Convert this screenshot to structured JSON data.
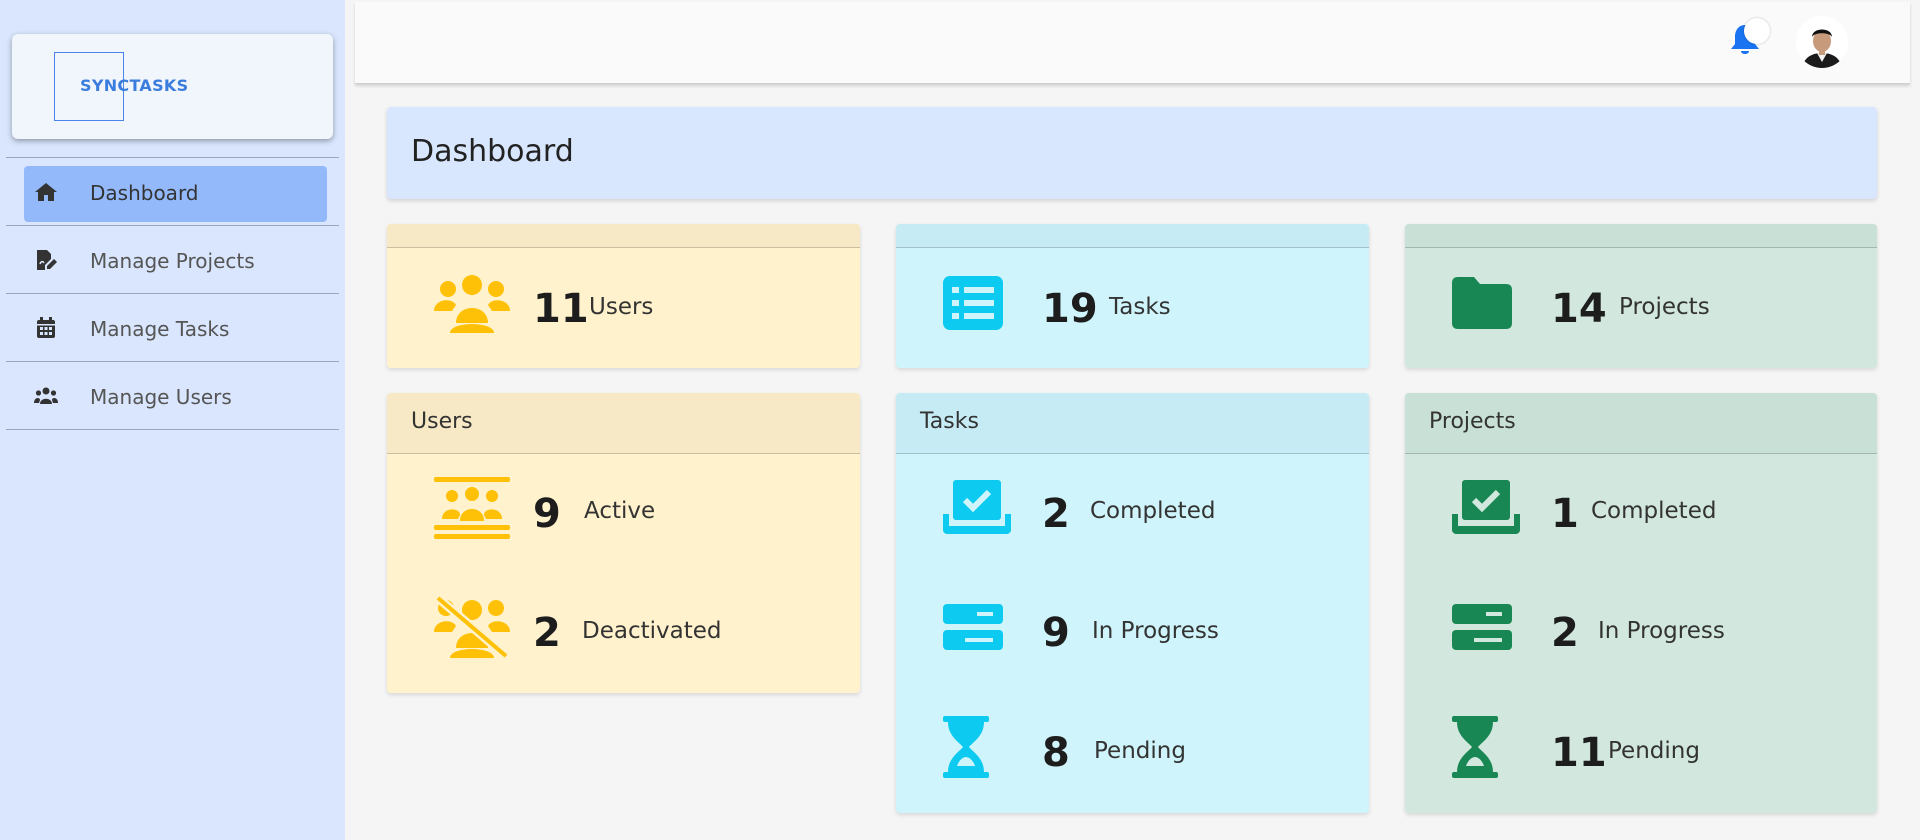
{
  "logo": {
    "text": "SYNCTASKS"
  },
  "sidebar": {
    "items": [
      {
        "label": "Dashboard",
        "icon": "home-icon",
        "active": true
      },
      {
        "label": "Manage Projects",
        "icon": "edit-document-icon"
      },
      {
        "label": "Manage Tasks",
        "icon": "calendar-icon"
      },
      {
        "label": "Manage Users",
        "icon": "users-icon"
      }
    ]
  },
  "topbar": {
    "bell_icon": "bell-icon",
    "avatar": "user-avatar"
  },
  "page": {
    "title": "Dashboard"
  },
  "colors": {
    "yellow": "#ffc107",
    "cyan": "#0dcaf0",
    "green": "#198754",
    "nav_active": "#93b9fb"
  },
  "summary": {
    "users": {
      "value": "11",
      "label": "Users"
    },
    "tasks": {
      "value": "19",
      "label": "Tasks"
    },
    "projects": {
      "value": "14",
      "label": "Projects"
    }
  },
  "users_card": {
    "title": "Users",
    "active": {
      "value": "9",
      "label": "Active"
    },
    "deactivated": {
      "value": "2",
      "label": "Deactivated"
    }
  },
  "tasks_card": {
    "title": "Tasks",
    "completed": {
      "value": "2",
      "label": "Completed"
    },
    "in_progress": {
      "value": "9",
      "label": "In Progress"
    },
    "pending": {
      "value": "8",
      "label": "Pending"
    }
  },
  "projects_card": {
    "title": "Projects",
    "completed": {
      "value": "1",
      "label": "Completed"
    },
    "in_progress": {
      "value": "2",
      "label": "In Progress"
    },
    "pending": {
      "value": "11",
      "label": "Pending"
    }
  }
}
